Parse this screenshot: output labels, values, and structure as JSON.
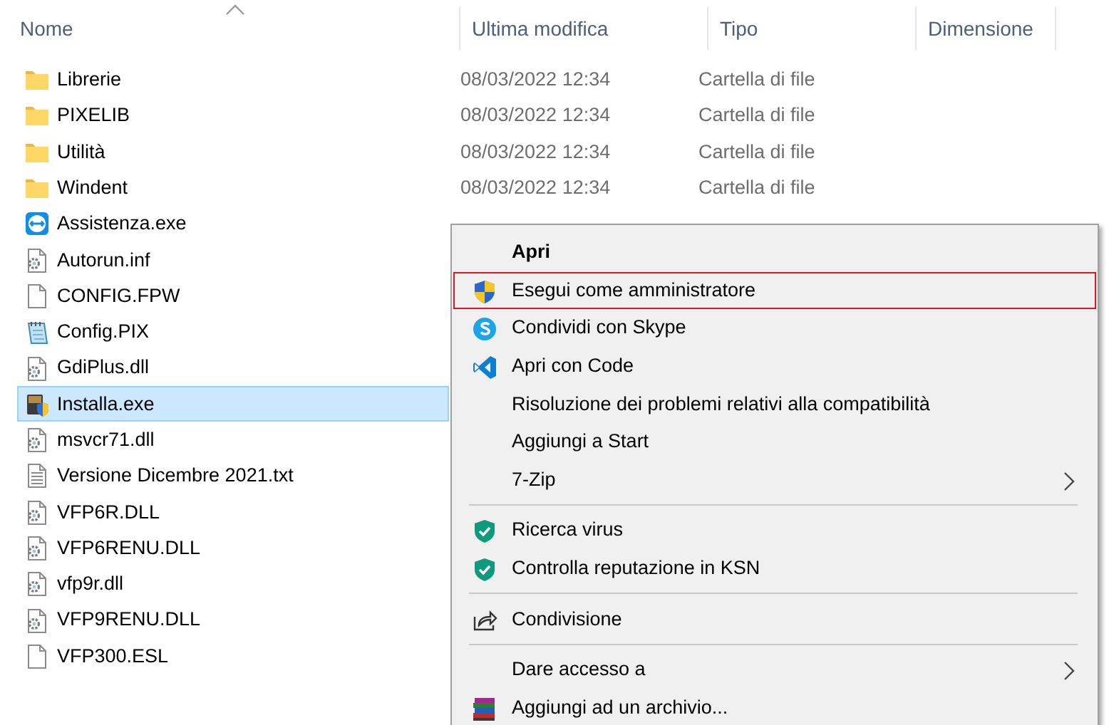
{
  "columns": [
    {
      "label": "Nome",
      "sorted": true
    },
    {
      "label": "Ultima modifica",
      "sorted": false
    },
    {
      "label": "Tipo",
      "sorted": false
    },
    {
      "label": "Dimensione",
      "sorted": false
    }
  ],
  "files": [
    {
      "kind": "folder",
      "name": "Librerie",
      "modified": "08/03/2022 12:34",
      "type": "Cartella di file",
      "selected": false
    },
    {
      "kind": "folder",
      "name": "PIXELIB",
      "modified": "08/03/2022 12:34",
      "type": "Cartella di file",
      "selected": false
    },
    {
      "kind": "folder",
      "name": "Utilità",
      "modified": "08/03/2022 12:34",
      "type": "Cartella di file",
      "selected": false
    },
    {
      "kind": "folder",
      "name": "Windent",
      "modified": "08/03/2022 12:34",
      "type": "Cartella di file",
      "selected": false
    },
    {
      "kind": "remote",
      "name": "Assistenza.exe",
      "selected": false
    },
    {
      "kind": "settings",
      "name": "Autorun.inf",
      "selected": false
    },
    {
      "kind": "blank",
      "name": "CONFIG.FPW",
      "selected": false
    },
    {
      "kind": "notepad",
      "name": "Config.PIX",
      "selected": false
    },
    {
      "kind": "settings",
      "name": "GdiPlus.dll",
      "selected": false
    },
    {
      "kind": "installer",
      "name": "Installa.exe",
      "selected": true
    },
    {
      "kind": "settings",
      "name": "msvcr71.dll",
      "selected": false
    },
    {
      "kind": "text",
      "name": "Versione Dicembre 2021.txt",
      "selected": false
    },
    {
      "kind": "settings",
      "name": "VFP6R.DLL",
      "selected": false
    },
    {
      "kind": "settings",
      "name": "VFP6RENU.DLL",
      "selected": false
    },
    {
      "kind": "settings",
      "name": "vfp9r.dll",
      "selected": false
    },
    {
      "kind": "settings",
      "name": "VFP9RENU.DLL",
      "selected": false
    },
    {
      "kind": "blank",
      "name": "VFP300.ESL",
      "selected": false
    }
  ],
  "context_menu": {
    "items": [
      {
        "kind": "plain",
        "label": "Apri",
        "default": true,
        "highlighted": false,
        "submenu": false
      },
      {
        "kind": "uac",
        "label": "Esegui come amministratore",
        "default": false,
        "highlighted": true,
        "submenu": false
      },
      {
        "kind": "skype",
        "label": "Condividi con Skype",
        "default": false,
        "highlighted": false,
        "submenu": false
      },
      {
        "kind": "code",
        "label": "Apri con Code",
        "default": false,
        "highlighted": false,
        "submenu": false
      },
      {
        "kind": "plain",
        "label": "Risoluzione dei problemi relativi alla compatibilità",
        "default": false,
        "highlighted": false,
        "submenu": false
      },
      {
        "kind": "plain",
        "label": "Aggiungi a Start",
        "default": false,
        "highlighted": false,
        "submenu": false
      },
      {
        "kind": "plain",
        "label": "7-Zip",
        "submenu": true,
        "default": false,
        "highlighted": false
      },
      {
        "kind": "separator"
      },
      {
        "kind": "antivirus",
        "label": "Ricerca virus",
        "default": false,
        "highlighted": false,
        "submenu": false
      },
      {
        "kind": "antivirus",
        "label": "Controlla reputazione in KSN",
        "default": false,
        "highlighted": false,
        "submenu": false
      },
      {
        "kind": "separator"
      },
      {
        "kind": "share",
        "label": "Condivisione",
        "default": false,
        "highlighted": false,
        "submenu": false
      },
      {
        "kind": "separator"
      },
      {
        "kind": "plain",
        "label": "Dare accesso a",
        "submenu": true,
        "default": false,
        "highlighted": false
      },
      {
        "kind": "archive",
        "label": "Aggiungi ad un archivio...",
        "default": false,
        "highlighted": false,
        "submenu": false
      }
    ]
  }
}
